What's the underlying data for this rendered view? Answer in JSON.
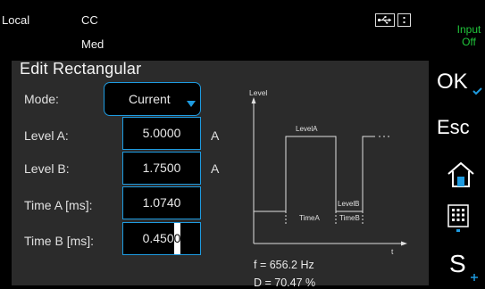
{
  "status": {
    "mode": "Local",
    "function": "CC",
    "speed": "Med",
    "input_label": "Input",
    "input_state": "Off",
    "input_color": "#20c43a",
    "icons": [
      "usb-icon",
      "keylock-icon"
    ]
  },
  "dialog": {
    "title": "Edit Rectangular",
    "mode_label": "Mode:",
    "mode_value": "Current",
    "fields": [
      {
        "label": "Level A:",
        "value": "5.0000",
        "unit": "A"
      },
      {
        "label": "Level B:",
        "value": "1.7500",
        "unit": "A"
      },
      {
        "label": "Time A [ms]:",
        "value": "1.0740",
        "unit": ""
      },
      {
        "label": "Time B [ms]:",
        "value": "0.450",
        "cursor_char": "0",
        "unit": ""
      }
    ]
  },
  "diagram": {
    "y_axis_label": "Level",
    "x_axis_label": "t",
    "level_a_label": "LevelA",
    "level_b_label": "LevelB",
    "time_a_label": "TimeA",
    "time_b_label": "TimeB",
    "frequency": "f = 656.2 Hz",
    "duty": "D = 70.47 %"
  },
  "sidebar": {
    "ok_label": "OK",
    "esc_label": "Esc",
    "s_label": "S",
    "icons": [
      "home-icon",
      "keypad-icon"
    ]
  },
  "colors": {
    "accent": "#1e9be0",
    "panel": "#2b2b2b",
    "background": "#000000"
  }
}
